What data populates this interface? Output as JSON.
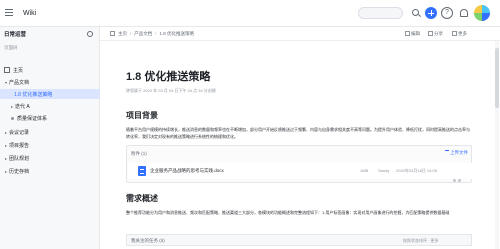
{
  "topbar": {
    "app_title": "Wiki"
  },
  "sidebar": {
    "title": "日常运营",
    "section_label": "页面树",
    "items": [
      {
        "label": "主页",
        "type": "home"
      },
      {
        "label": "产品文档",
        "type": "expanded"
      },
      {
        "label": "1.8 优化推送策略",
        "type": "child-active"
      },
      {
        "label": "迭代 A",
        "type": "collapsed-child"
      },
      {
        "label": "质量保证体系",
        "type": "child"
      },
      {
        "label": "会议记录",
        "type": "collapsed"
      },
      {
        "label": "项目报告",
        "type": "collapsed"
      },
      {
        "label": "团队规划",
        "type": "collapsed"
      },
      {
        "label": "历史存档",
        "type": "collapsed"
      }
    ]
  },
  "breadcrumb": {
    "home": "主页",
    "level1": "产品文档",
    "level2": "1.8 优化推送策略"
  },
  "actions": {
    "edit": "编辑",
    "share": "分享",
    "more": "更多"
  },
  "document": {
    "title": "1.8 优化推送策略",
    "meta": "钟思颖于 2020 年 03 月 04 日下午 04 点 34 分创建",
    "section1_heading": "项目背景",
    "section1_text": "随着平台用户规模的持续增长，推送消息的数量和频率也在不断增加，部分用户开始反馈推送过于频繁、内容与自身需求相关度不高等问题。为提升用户体验、降低打扰，同时提高推送的点击率与转化率，我们决定对现有的推送策略进行系统性的梳理和优化。",
    "attachment": {
      "header": "附件 (1)",
      "upload": "上传文件",
      "file_name": "企业服务产品战略的思考与实践.docx",
      "file_size": "1MB",
      "file_owner": "Sandy",
      "file_time": "2020年03月18日 14:05"
    },
    "section2_heading": "需求概述",
    "section2_text": "整个推荐功能分为用户和消息推送、频次和匹配策略、推送渠道三大部分，各模块的功能概述和完整流程如下：1.用户标签画像：实现对用户画像进行的挖掘，为匹配策略提供数据基础",
    "table": {
      "header_left": "我关注的任务 (5)",
      "header_right": "按照状态排序 · 更多"
    }
  }
}
